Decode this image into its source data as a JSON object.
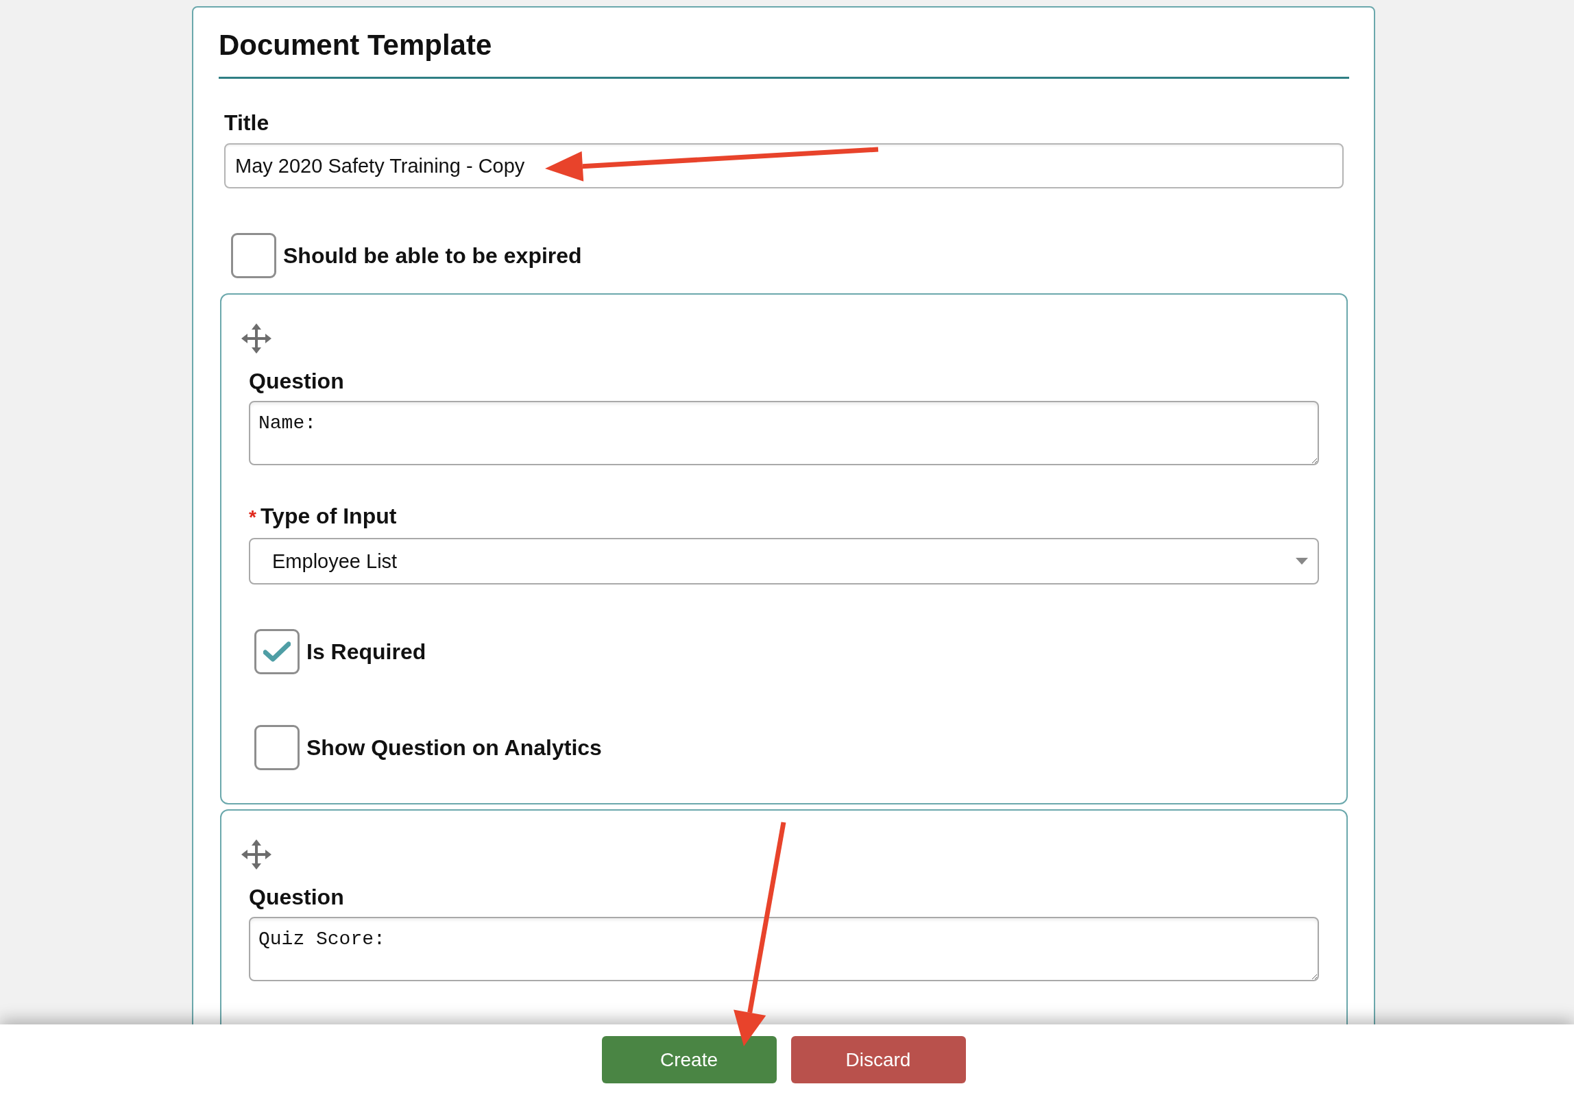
{
  "page": {
    "heading": "Document Template"
  },
  "title_field": {
    "label": "Title",
    "value": "May 2020 Safety Training - Copy"
  },
  "expirable": {
    "label": "Should be able to be expired",
    "checked": false
  },
  "questions": [
    {
      "label": "Question",
      "value": "Name:",
      "input_type": {
        "required_mark": "*",
        "label": "Type of Input",
        "value": "Employee List"
      },
      "options": [
        {
          "label": "Is Required",
          "checked": true
        },
        {
          "label": "Show Question on Analytics",
          "checked": false
        }
      ]
    },
    {
      "label": "Question",
      "value": "Quiz Score:"
    }
  ],
  "footer": {
    "buttons": [
      {
        "label": "Create",
        "kind": "primary"
      },
      {
        "label": "Discard",
        "kind": "danger"
      }
    ]
  }
}
